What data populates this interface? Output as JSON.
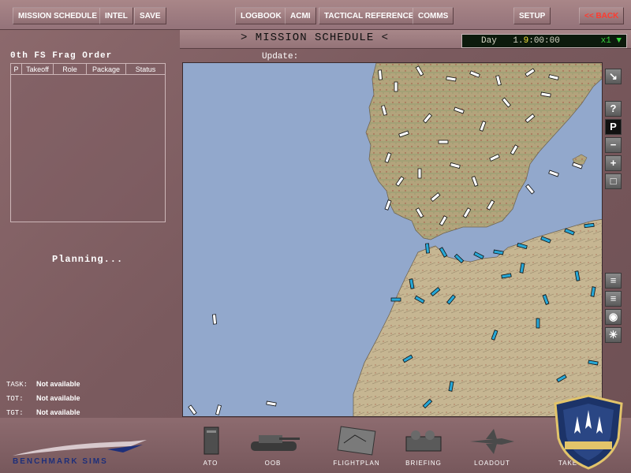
{
  "menu": {
    "mission_schedule": "MISSION SCHEDULE",
    "intel": "INTEL",
    "save": "SAVE",
    "logbook": "LOGBOOK",
    "acmi": "ACMI",
    "tactical_reference": "TACTICAL REFERENCE",
    "comms": "COMMS",
    "setup": "SETUP",
    "back": "<< BACK"
  },
  "header": {
    "title": ">  MISSION SCHEDULE  <",
    "clock_day_label": "Day",
    "clock_day": "1.",
    "clock_hour": "9",
    "clock_rest": ":00:00",
    "clock_speed": "x1 ▼"
  },
  "frag_order": {
    "title": "0th FS Frag Order",
    "columns": [
      "P",
      "Takeoff",
      "Role",
      "Package",
      "Status"
    ]
  },
  "status": {
    "planning": "Planning...",
    "update_label": "Update:"
  },
  "info": [
    {
      "label": "TASK:",
      "value": "Not available"
    },
    {
      "label": "TOT:",
      "value": "Not available"
    },
    {
      "label": "TGT:",
      "value": "Not available"
    }
  ],
  "map": {
    "sea_color": "#92a8cc",
    "land_north_color": "#b4a67e",
    "land_south_color": "#c7b894",
    "friendly_unit_color": "#ffffff",
    "hostile_unit_color": "#27a7d6"
  },
  "toolbar": {
    "help": "?",
    "pause": "P"
  },
  "bottom_nav": [
    {
      "label": "ATO"
    },
    {
      "label": "OOB"
    },
    {
      "label": "FLIGHTPLAN"
    },
    {
      "label": "BRIEFING"
    },
    {
      "label": "LOADOUT"
    },
    {
      "label": "TAKE"
    }
  ],
  "logo": {
    "text": "BENCHMARK SIMS"
  },
  "colors": {
    "background": "#7a5a5e",
    "back_button": "#ff3b2f",
    "clock_highlight": "#f2e23a",
    "clock_speed": "#37d43c"
  }
}
